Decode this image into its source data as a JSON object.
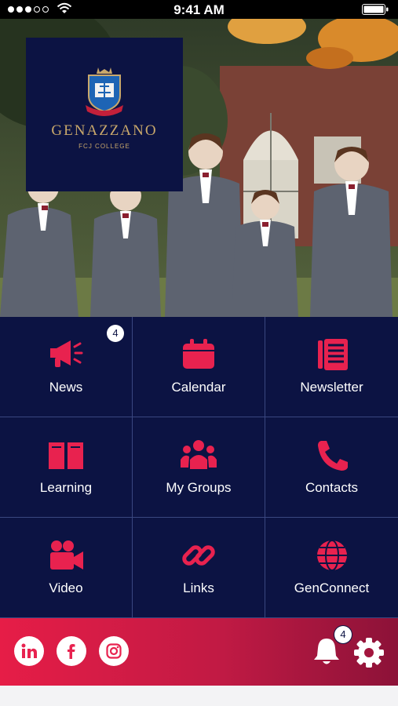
{
  "status_bar": {
    "time": "9:41 AM"
  },
  "logo": {
    "name": "GENAZZANO",
    "subtitle": "FCJ COLLEGE"
  },
  "tiles": [
    {
      "label": "News",
      "icon": "megaphone-icon",
      "badge": "4"
    },
    {
      "label": "Calendar",
      "icon": "calendar-icon"
    },
    {
      "label": "Newsletter",
      "icon": "newsletter-icon"
    },
    {
      "label": "Learning",
      "icon": "book-icon"
    },
    {
      "label": "My Groups",
      "icon": "group-icon"
    },
    {
      "label": "Contacts",
      "icon": "phone-icon"
    },
    {
      "label": "Video",
      "icon": "video-camera-icon"
    },
    {
      "label": "Links",
      "icon": "link-icon"
    },
    {
      "label": "GenConnect",
      "icon": "globe-icon"
    }
  ],
  "footer": {
    "notification_count": "4"
  },
  "colors": {
    "navy": "#0c1343",
    "accent": "#e8224f",
    "gold": "#c9a86b"
  }
}
